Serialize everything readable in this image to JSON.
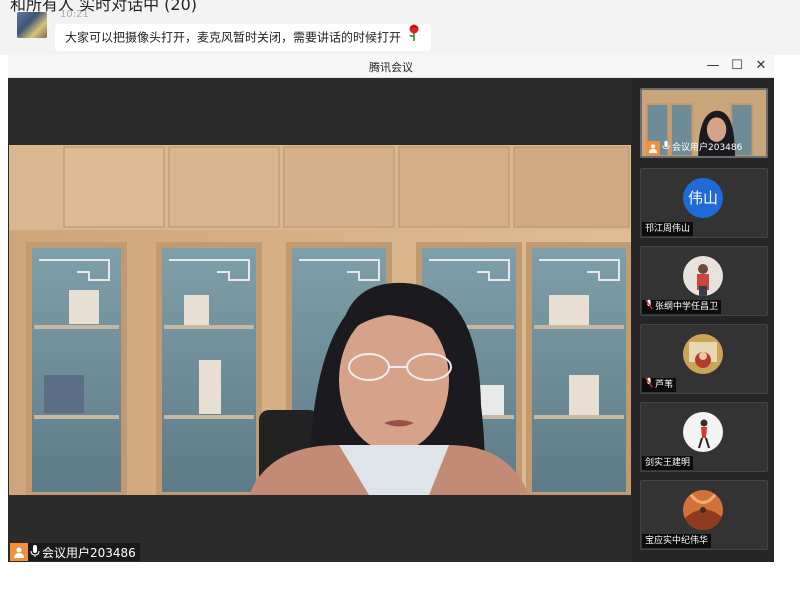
{
  "chat": {
    "top_title": "和所有人 实时对话中 (20)",
    "timestamp": "10:21",
    "message": "大家可以把摄像头打开，麦克风暂时关闭，需要讲话的时候打开",
    "emoji": "rose-icon"
  },
  "window": {
    "title": "腾讯会议",
    "minimize_glyph": "—",
    "maximize_glyph": "☐",
    "close_glyph": "✕"
  },
  "main_speaker": {
    "label": "会议用户203486",
    "icon": "person-icon",
    "mic": "mic-on-icon"
  },
  "participants": [
    {
      "name": "会议用户203486",
      "avatar_type": "video",
      "mic": "mic-on-icon",
      "active": true
    },
    {
      "name": "邗江周伟山",
      "avatar_type": "text",
      "avatar_text": "伟山",
      "mic": "none"
    },
    {
      "name": "张纲中学任昌卫",
      "avatar_type": "photo",
      "mic": "mic-muted-icon"
    },
    {
      "name": "芦苇",
      "avatar_type": "photo",
      "mic": "mic-muted-icon"
    },
    {
      "name": "剑实王建明",
      "avatar_type": "photo",
      "mic": "none"
    },
    {
      "name": "宝应实中纪伟华",
      "avatar_type": "photo",
      "mic": "none"
    }
  ],
  "colors": {
    "avatar_blue": "#1e6bd6",
    "speaker_orange": "#f2913a",
    "meeting_bg": "#2a2a2a"
  }
}
